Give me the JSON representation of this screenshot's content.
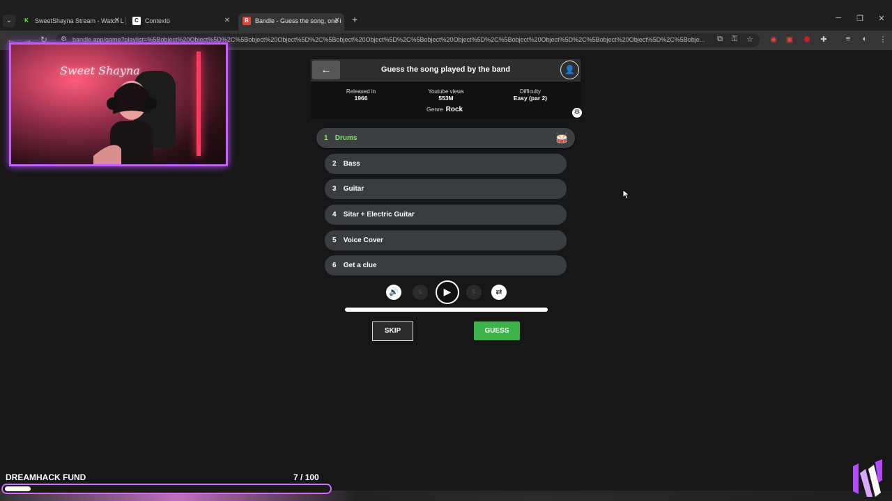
{
  "browser": {
    "tabs": [
      {
        "title": "SweetShayna Stream - Watch Li",
        "favicon": "K",
        "favicon_color": "#53fc18",
        "active": false
      },
      {
        "title": "Contexto",
        "favicon": "C",
        "favicon_color": "#ffffff",
        "active": false
      },
      {
        "title": "Bandle - Guess the song, one i",
        "favicon": "B",
        "favicon_color": "#e0463a",
        "active": true
      }
    ],
    "new_tab_symbol": "+",
    "url": "bandle.app/game?playlist=%5Bobject%20Object%5D%2C%5Bobject%20Object%5D%2C%5Bobject%20Object%5D%2C%5Bobject%20Object%5D%2C%5Bobject%20Object%5D%2C%5Bobject%20Object%5D%2C%5Bobje..."
  },
  "webcam": {
    "neon_sign": "Sweet Shayna"
  },
  "game": {
    "title": "Guess the song played by the band",
    "info": {
      "released_label": "Released in",
      "released_value": "1966",
      "views_label": "Youtube views",
      "views_value": "553M",
      "difficulty_label": "Difficulty",
      "difficulty_value": "Easy (par 2)",
      "genre_label": "Genre",
      "genre_value": "Rock"
    },
    "tracks": [
      {
        "num": "1",
        "label": "Drums",
        "active": true
      },
      {
        "num": "2",
        "label": "Bass",
        "active": false
      },
      {
        "num": "3",
        "label": "Guitar",
        "active": false
      },
      {
        "num": "4",
        "label": "Sitar + Electric Guitar",
        "active": false
      },
      {
        "num": "5",
        "label": "Voice Cover",
        "active": false
      },
      {
        "num": "6",
        "label": "Get a clue",
        "active": false
      }
    ],
    "controls": {
      "rewind_seconds": "5",
      "forward_seconds": "5"
    },
    "skip_label": "SKIP",
    "guess_label": "GUESS"
  },
  "fund": {
    "label": "DREAMHACK FUND",
    "count": "7",
    "total": "/ 100",
    "progress": 0.07
  },
  "colors": {
    "accent_purple": "#c85cff",
    "guess_green": "#3bb54a",
    "active_track_text": "#8fe36a"
  }
}
